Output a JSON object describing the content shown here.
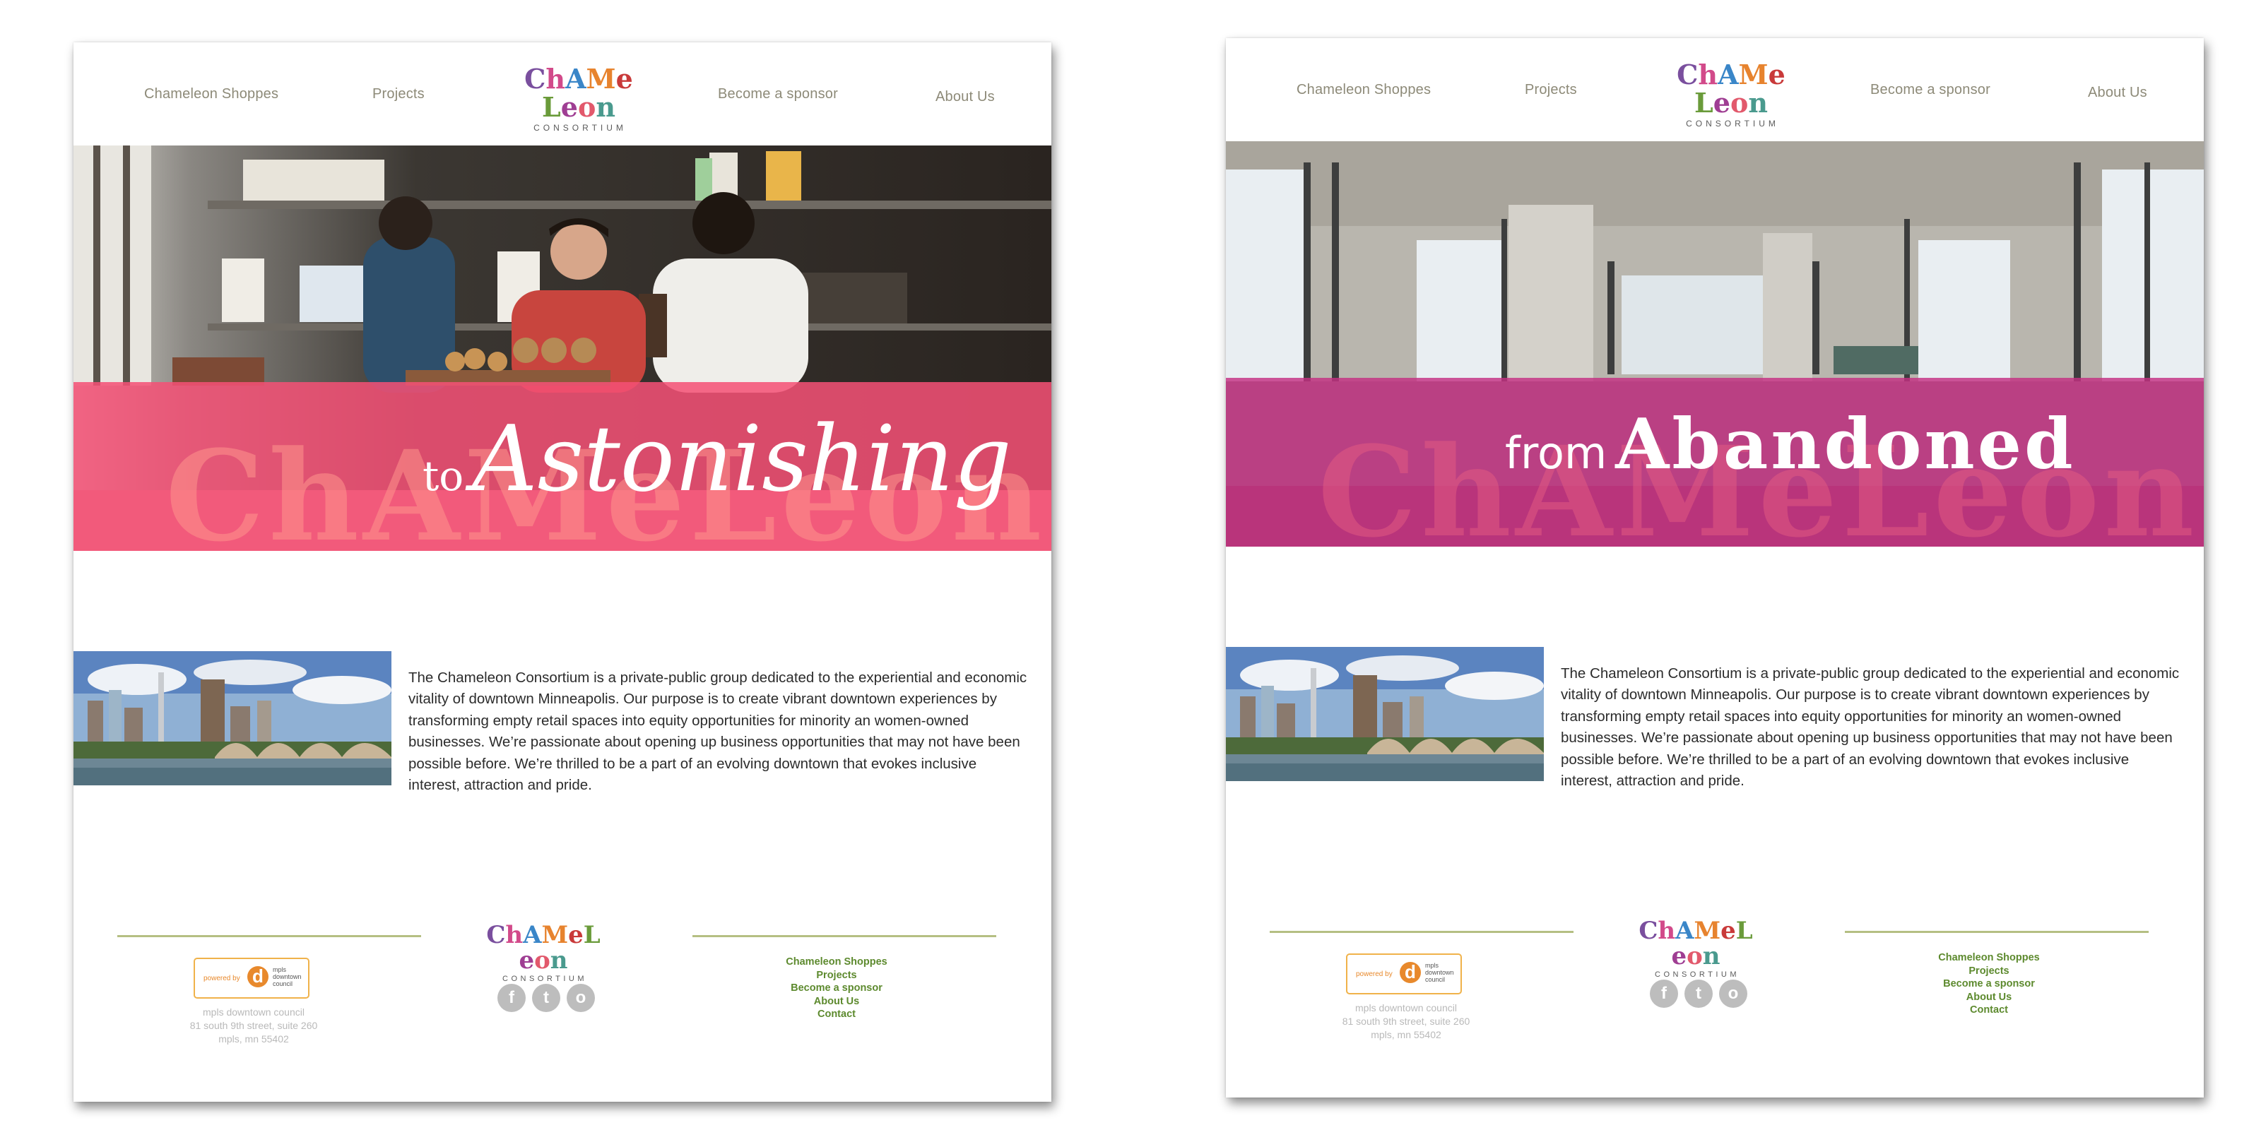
{
  "pages": [
    {
      "id": "left",
      "nav": {
        "item1": "Chameleon Shoppes",
        "item2": "Projects",
        "item3": "Become a sponsor",
        "item4": "About Us"
      },
      "logo": {
        "word": "ChAMeLeon",
        "sub": "CONSORTIUM"
      },
      "hero": {
        "prefix": "to",
        "word": "Astonishing",
        "ghost": "ChAMeLeon",
        "band_color": "#e8547a",
        "band_dark": "#f2577b"
      },
      "about": {
        "text": "The Chameleon Consortium is a private-public group dedicated to the experiential and economic vitality of downtown Minneapolis. Our purpose is to create vibrant downtown experiences by transforming empty retail spaces into equity opportunities for minority an women-owned businesses. We’re passionate about opening up business opportunities that may not have been possible before. We’re thrilled to be a part of an evolving downtown that evokes inclusive interest, attraction and pride."
      },
      "footer": {
        "logo_word": "ChAMeLeon",
        "logo_sub": "CONSORTIUM",
        "badge": {
          "powered": "powered by",
          "mark": "d",
          "org": "mpls downtown council"
        },
        "address": [
          "mpls downtown council",
          "81 south 9th street, suite 260",
          "mpls, mn 55402"
        ],
        "links": [
          "Chameleon Shoppes",
          "Projects",
          "Become a sponsor",
          "About Us",
          "Contact"
        ],
        "social": [
          "f",
          "t",
          "o"
        ]
      }
    },
    {
      "id": "right",
      "nav": {
        "item1": "Chameleon Shoppes",
        "item2": "Projects",
        "item3": "Become a sponsor",
        "item4": "About Us"
      },
      "logo": {
        "word": "ChAMeLeon",
        "sub": "CONSORTIUM"
      },
      "hero": {
        "prefix": "from",
        "word": "Abandoned",
        "ghost": "ChAMeLeon",
        "band_color": "#c2337e",
        "band_dark": "#b33176"
      },
      "about": {
        "text": "The Chameleon Consortium is a private-public group dedicated to the experiential and economic vitality of downtown Minneapolis. Our purpose is to create vibrant downtown experiences by transforming empty retail spaces into equity opportunities for minority an women-owned businesses. We’re passionate about opening up business opportunities that may not have been possible before. We’re thrilled to be a part of an evolving downtown that evokes inclusive interest, attraction and pride."
      },
      "footer": {
        "logo_word": "ChAMeLeon",
        "logo_sub": "CONSORTIUM",
        "badge": {
          "powered": "powered by",
          "mark": "d",
          "org": "mpls downtown council"
        },
        "address": [
          "mpls downtown council",
          "81 south 9th street, suite 260",
          "mpls, mn 55402"
        ],
        "links": [
          "Chameleon Shoppes",
          "Projects",
          "Become a sponsor",
          "About Us",
          "Contact"
        ],
        "social": [
          "f",
          "t",
          "o"
        ]
      }
    }
  ],
  "colors": {
    "nav_text": "#8d8a78",
    "footer_link": "#5d8a2e",
    "footer_rule": "#b5bf83",
    "logo_letters": [
      "#7a4f9e",
      "#d24a8a",
      "#3a86c8",
      "#e7832e",
      "#c93a3a",
      "#6a9b3a",
      "#9f3e93",
      "#e2596c",
      "#4a9a8e"
    ]
  }
}
